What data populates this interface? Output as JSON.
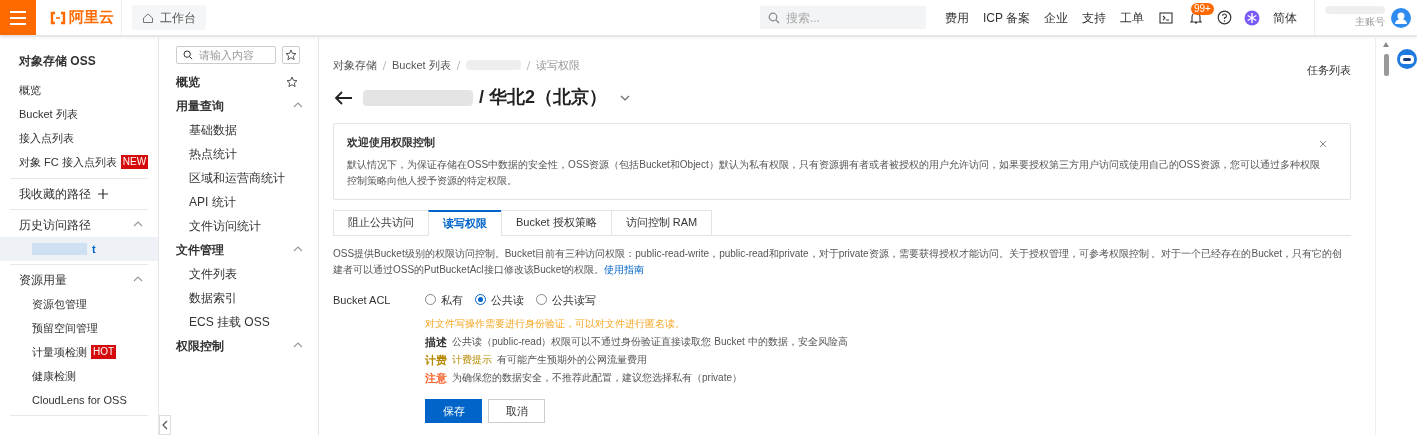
{
  "topbar": {
    "brand": "阿里云",
    "workbench": "工作台",
    "search_placeholder": "搜索...",
    "nav": [
      {
        "kind": "text",
        "label": "费用"
      },
      {
        "kind": "text",
        "label": "ICP 备案"
      },
      {
        "kind": "text",
        "label": "企业"
      },
      {
        "kind": "text",
        "label": "支持"
      },
      {
        "kind": "text",
        "label": "工单"
      },
      {
        "kind": "terminal"
      },
      {
        "kind": "bell",
        "badge": "99+"
      },
      {
        "kind": "help"
      },
      {
        "kind": "ai"
      },
      {
        "kind": "text",
        "label": "简体"
      }
    ],
    "account_role": "主账号"
  },
  "sidebar": {
    "title": "对象存储 OSS",
    "items": [
      {
        "label": "概览"
      },
      {
        "label": "Bucket 列表"
      },
      {
        "label": "接入点列表"
      },
      {
        "label": "对象 FC 接入点列表",
        "badge": "NEW"
      }
    ],
    "sections": [
      {
        "kind": "add",
        "label": "我收藏的路径"
      },
      {
        "kind": "collapsible",
        "label": "历史访问路径",
        "expanded": true,
        "children": [
          {
            "label": "t",
            "selected": true
          }
        ]
      },
      {
        "kind": "collapsible",
        "label": "资源用量",
        "expanded": true,
        "children": [
          {
            "label": "资源包管理"
          },
          {
            "label": "预留空间管理"
          },
          {
            "label": "计量项检测",
            "badge": "HOT"
          },
          {
            "label": "健康检测"
          },
          {
            "label": "CloudLens for OSS"
          }
        ]
      }
    ]
  },
  "secondary_nav": {
    "search_placeholder": "请输入内容",
    "items": [
      {
        "kind": "link",
        "label": "概览"
      },
      {
        "kind": "group",
        "label": "用量查询",
        "expanded": true,
        "children": [
          {
            "label": "基础数据"
          },
          {
            "label": "热点统计"
          },
          {
            "label": "区域和运营商统计"
          },
          {
            "label": "API 统计"
          },
          {
            "label": "文件访问统计"
          }
        ]
      },
      {
        "kind": "group",
        "label": "文件管理",
        "expanded": true,
        "children": [
          {
            "label": "文件列表"
          },
          {
            "label": "数据索引"
          },
          {
            "label": "ECS 挂载 OSS"
          }
        ]
      },
      {
        "kind": "group",
        "label": "权限控制",
        "expanded": true
      }
    ]
  },
  "breadcrumb": [
    {
      "kind": "text",
      "label": "对象存储"
    },
    {
      "kind": "text",
      "label": "Bucket 列表"
    },
    {
      "kind": "redacted"
    },
    {
      "kind": "text",
      "label": "读写权限"
    }
  ],
  "title": "/ 华北2（北京）",
  "task_list": "任务列表",
  "notice": {
    "title": "欢迎使用权限控制",
    "text": "默认情况下，为保证存储在OSS中数据的安全性，OSS资源（包括Bucket和Object）默认为私有权限，只有资源拥有者或者被授权的用户允许访问，如果要授权第三方用户访问或使用自己的OSS资源，您可以通过多种权限控制策略向他人授予资源的特定权限。"
  },
  "tabs": [
    {
      "label": "阻止公共访问",
      "selected": false
    },
    {
      "label": "读写权限",
      "selected": true
    },
    {
      "label": "Bucket 授权策略",
      "selected": false
    },
    {
      "label": "访问控制 RAM",
      "selected": false
    }
  ],
  "description": {
    "text": "OSS提供Bucket级别的权限访问控制。Bucket目前有三种访问权限：public-read-write，public-read和private，对于private资源，需要获得授权才能访问。关于授权管理，可参考权限控制 。对于一个已经存在的Bucket，只有它的创建者可以通过OSS的PutBucketAcl接口修改该Bucket的权限。",
    "link": "使用指南"
  },
  "acl": {
    "label": "Bucket ACL",
    "options": [
      {
        "label": "私有",
        "selected": false
      },
      {
        "label": "公共读",
        "selected": true
      },
      {
        "label": "公共读写",
        "selected": false
      }
    ],
    "warning": "对文件写操作需要进行身份验证，可以对文件进行匿名读。",
    "notes": [
      {
        "label": "描述",
        "color": "#333333",
        "text": "公共读（public-read）权限可以不通过身份验证直接读取您 Bucket 中的数据，安全风险高"
      },
      {
        "label": "计费",
        "color": "#b58a00",
        "link": "计费提示",
        "text": "有可能产生预期外的公网流量费用"
      },
      {
        "label": "注意",
        "color": "#f5622d",
        "text": "为确保您的数据安全，不推荐此配置，建议您选择私有（private）"
      }
    ]
  },
  "buttons": [
    {
      "kind": "primary",
      "label": "保存"
    },
    {
      "kind": "default",
      "label": "取消"
    }
  ]
}
